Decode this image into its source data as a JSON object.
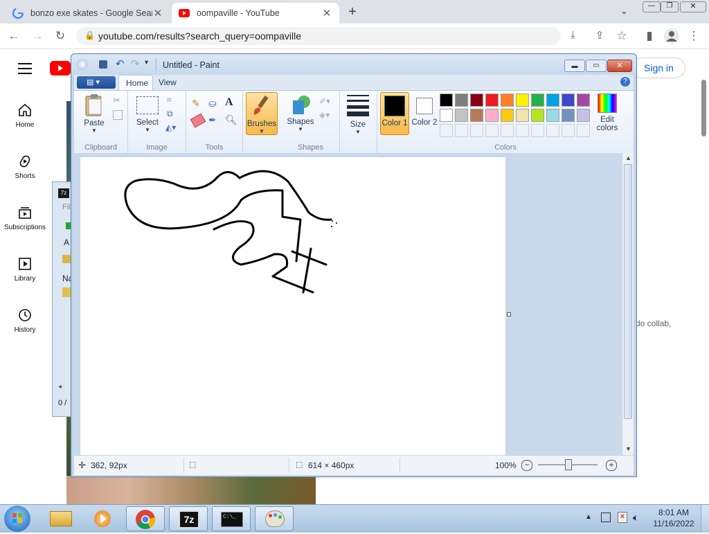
{
  "browser": {
    "tabs": [
      {
        "title": "bonzo exe skates - Google Searc"
      },
      {
        "title": "oompaville - YouTube"
      }
    ],
    "new_tab_symbol": "+",
    "url": "youtube.com/results?search_query=oompaville",
    "icons": [
      "back-icon",
      "forward-icon",
      "reload-icon",
      "lock-icon",
      "install-icon",
      "share-icon",
      "bookmark-star-icon",
      "side-panel-icon",
      "profile-icon",
      "menu-dots-icon"
    ]
  },
  "youtube": {
    "sign_in": "Sign in",
    "sidebar": [
      {
        "label": "Home",
        "icon": "home-icon"
      },
      {
        "label": "Shorts",
        "icon": "shorts-icon"
      },
      {
        "label": "Subscriptions",
        "icon": "subscriptions-icon"
      },
      {
        "label": "Library",
        "icon": "library-icon"
      },
      {
        "label": "History",
        "icon": "history-icon"
      }
    ],
    "snippet": "do collab,"
  },
  "zip_window": {
    "menu_fragment": "Fil",
    "toolbar_fragment": "A",
    "column_fragment": "Na",
    "status_fragment": "0 /"
  },
  "paint": {
    "title": "Untitled - Paint",
    "tabs": [
      "Home",
      "View"
    ],
    "groups": {
      "clipboard": {
        "label": "Clipboard",
        "paste": "Paste"
      },
      "image": {
        "label": "Image",
        "select": "Select"
      },
      "tools": {
        "label": "Tools"
      },
      "brushes": {
        "label": "Brushes"
      },
      "shapes": {
        "label": "Shapes",
        "shapes_btn": "Shapes"
      },
      "size": {
        "label": "Size"
      },
      "colors": {
        "label": "Colors",
        "color1": "Color 1",
        "color2": "Color 2",
        "edit": "Edit colors"
      }
    },
    "palette_row1": [
      "#000000",
      "#7f7f7f",
      "#880015",
      "#ed1c24",
      "#ff7f27",
      "#fff200",
      "#22b14c",
      "#00a2e8",
      "#3f48cc",
      "#a349a4"
    ],
    "palette_row2": [
      "#ffffff",
      "#c3c3c3",
      "#b97a57",
      "#ffaec9",
      "#ffc90e",
      "#efe4b0",
      "#b5e61d",
      "#99d9ea",
      "#7092be",
      "#c8bfe7"
    ],
    "color1_value": "#000000",
    "color2_value": "#ffffff",
    "status": {
      "cursor_pos": "362, 92px",
      "canvas_size": "614 × 460px",
      "zoom": "100%"
    }
  },
  "taskbar": {
    "time": "8:01 AM",
    "date": "11/16/2022",
    "apps": [
      "start-orb-icon",
      "file-explorer-icon",
      "media-player-icon",
      "chrome-icon",
      "7zip-icon",
      "cmd-icon",
      "paint-icon"
    ],
    "zip_label": "7z"
  }
}
